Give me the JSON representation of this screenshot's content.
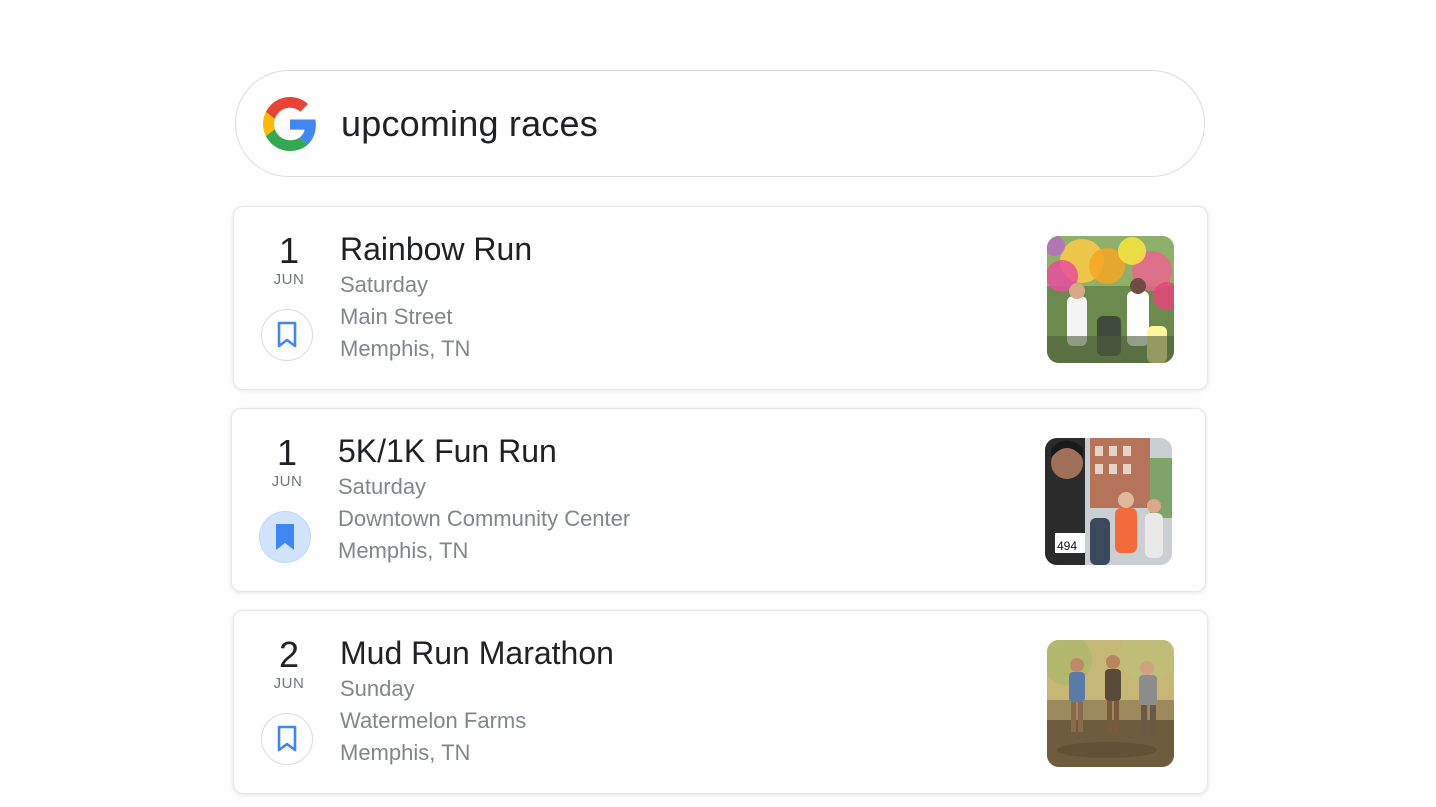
{
  "search": {
    "query": "upcoming races",
    "logo_icon": "google-g-logo"
  },
  "results": [
    {
      "day": "1",
      "month": "JUN",
      "title": "Rainbow Run",
      "weekday": "Saturday",
      "venue": "Main Street",
      "city": "Memphis, TN",
      "saved": false,
      "image": "color-run-photo"
    },
    {
      "day": "1",
      "month": "JUN",
      "title": "5K/1K Fun Run",
      "weekday": "Saturday",
      "venue": "Downtown Community Center",
      "city": "Memphis, TN",
      "saved": true,
      "image": "city-runners-photo"
    },
    {
      "day": "2",
      "month": "JUN",
      "title": "Mud Run Marathon",
      "weekday": "Sunday",
      "venue": "Watermelon Farms",
      "city": "Memphis, TN",
      "saved": false,
      "image": "mud-run-photo"
    }
  ],
  "colors": {
    "accent_blue": "#4285f4",
    "saved_bg": "#d2e3fc",
    "text_primary": "#202124",
    "text_secondary": "#80868b"
  }
}
